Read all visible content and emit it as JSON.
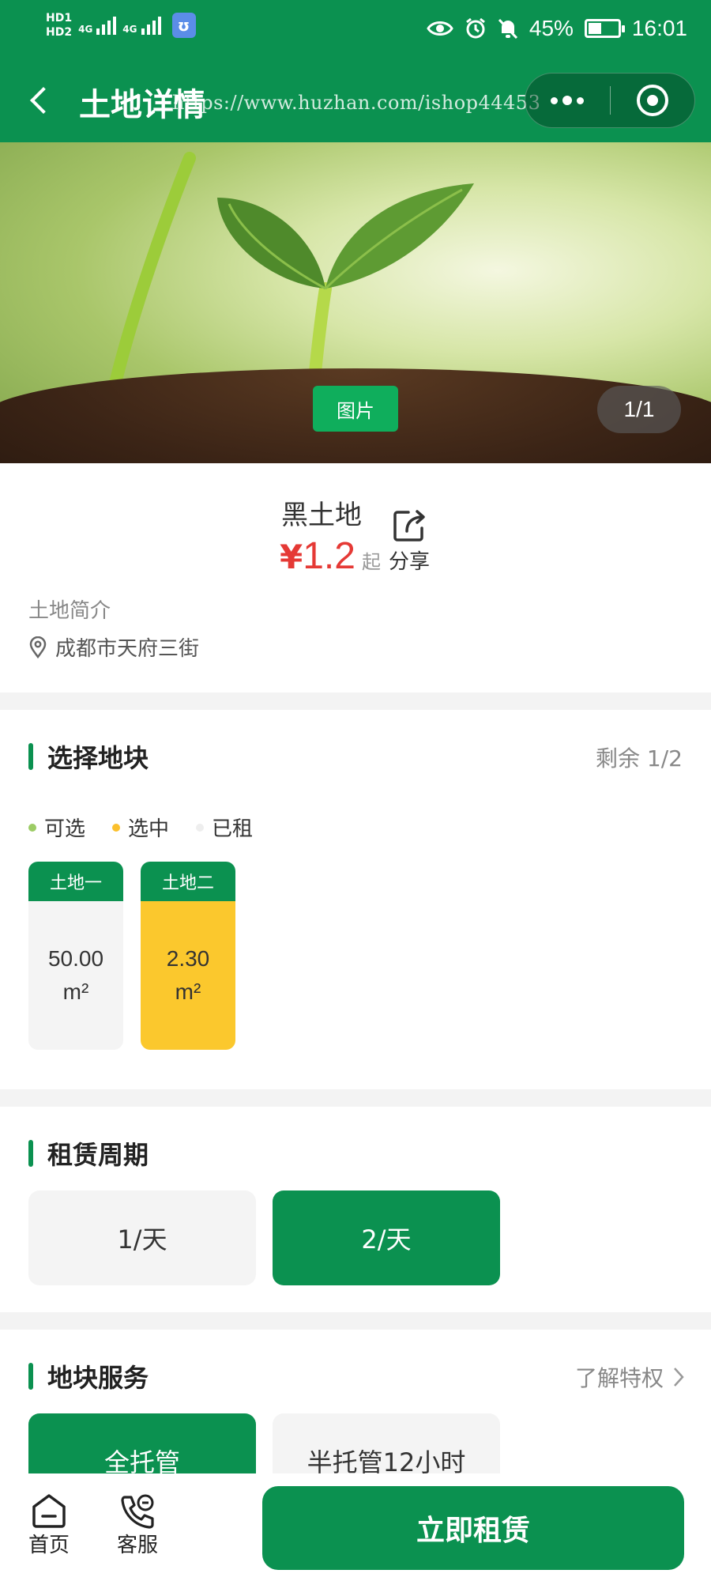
{
  "status_bar": {
    "hd1": "HD",
    "hd1_sub": "1",
    "hd2": "HD",
    "hd2_sub": "2",
    "network1": "4G",
    "network2": "4G",
    "battery": "45%",
    "battery_level": 0.45,
    "time": "16:01"
  },
  "header": {
    "title": "土地详情",
    "watermark": "https://www.huzhan.com/ishop44453"
  },
  "banner": {
    "tag": "图片",
    "counter": "1/1"
  },
  "land": {
    "name": "黑土地",
    "price_symbol": "¥",
    "price": "1.2",
    "price_suffix": "起",
    "share_label": "分享",
    "intro_label": "土地简介",
    "address": "成都市天府三街"
  },
  "plot_section": {
    "title": "选择地块",
    "remaining": "剩余 1/2",
    "legend": [
      {
        "label": "可选",
        "color": "#9ccc65"
      },
      {
        "label": "选中",
        "color": "#fbc02d"
      },
      {
        "label": "已租",
        "color": "#eeeeee"
      }
    ],
    "plots": [
      {
        "name": "土地一",
        "area": "50.00",
        "unit": "m²",
        "state": "available"
      },
      {
        "name": "土地二",
        "area": "2.30",
        "unit": "m²",
        "state": "selected"
      }
    ]
  },
  "period_section": {
    "title": "租赁周期",
    "options": [
      {
        "label": "1/天",
        "selected": false
      },
      {
        "label": "2/天",
        "selected": true
      }
    ]
  },
  "service_section": {
    "title": "地块服务",
    "link": "了解特权",
    "options": [
      {
        "label": "全托管",
        "selected": true
      },
      {
        "label": "半托管12小时",
        "selected": false
      }
    ]
  },
  "bottom_bar": {
    "home": "首页",
    "service": "客服",
    "rent_button": "立即租赁"
  },
  "colors": {
    "primary": "#0b9150",
    "price": "#e53935",
    "selected_plot": "#fbc02d"
  }
}
